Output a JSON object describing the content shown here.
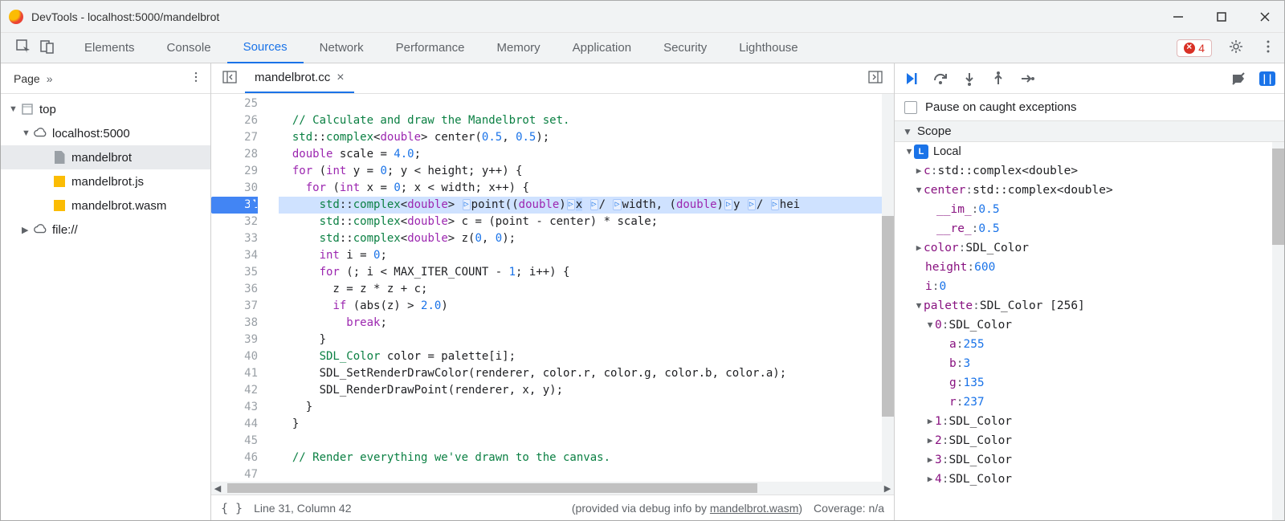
{
  "window": {
    "title": "DevTools - localhost:5000/mandelbrot"
  },
  "tabs": {
    "items": [
      "Elements",
      "Console",
      "Sources",
      "Network",
      "Performance",
      "Memory",
      "Application",
      "Security",
      "Lighthouse"
    ],
    "active": "Sources",
    "error_count": "4"
  },
  "nav": {
    "header": "Page",
    "tree": {
      "top": "top",
      "host": "localhost:5000",
      "files": [
        "mandelbrot",
        "mandelbrot.js",
        "mandelbrot.wasm"
      ],
      "filescheme": "file://",
      "selected": "mandelbrot"
    }
  },
  "editor": {
    "filename": "mandelbrot.cc",
    "first_line": 25,
    "breakpoint_line": 31,
    "lines": [
      "",
      "  // Calculate and draw the Mandelbrot set.",
      "  std::complex<double> center(0.5, 0.5);",
      "  double scale = 4.0;",
      "  for (int y = 0; y < height; y++) {",
      "    for (int x = 0; x < width; x++) {",
      "      std::complex<double> ▯point((double)▯x ▯/ ▯width, (double)▯y ▯/ ▯hei",
      "      std::complex<double> c = (point - center) * scale;",
      "      std::complex<double> z(0, 0);",
      "      int i = 0;",
      "      for (; i < MAX_ITER_COUNT - 1; i++) {",
      "        z = z * z + c;",
      "        if (abs(z) > 2.0)",
      "          break;",
      "      }",
      "      SDL_Color color = palette[i];",
      "      SDL_SetRenderDrawColor(renderer, color.r, color.g, color.b, color.a);",
      "      SDL_RenderDrawPoint(renderer, x, y);",
      "    }",
      "  }",
      "",
      "  // Render everything we've drawn to the canvas.",
      ""
    ]
  },
  "status": {
    "cursor": "Line 31, Column 42",
    "debuginfo_prefix": "(provided via debug info by ",
    "debuginfo_link": "mandelbrot.wasm",
    "debuginfo_suffix": ")",
    "coverage": "Coverage: n/a"
  },
  "debugger": {
    "pause_caught": "Pause on caught exceptions",
    "scope_label": "Scope",
    "local_label": "Local",
    "vars": {
      "c": {
        "type": "std::complex<double>"
      },
      "center": {
        "type": "std::complex<double>",
        "__im_": "0.5",
        "__re_": "0.5"
      },
      "color": {
        "type": "SDL_Color"
      },
      "height": "600",
      "i": "0",
      "palette": {
        "type": "SDL_Color [256]",
        "0": {
          "type": "SDL_Color",
          "a": "255",
          "b": "3",
          "g": "135",
          "r": "237"
        },
        "1": {
          "type": "SDL_Color"
        },
        "2": {
          "type": "SDL_Color"
        },
        "3": {
          "type": "SDL_Color"
        },
        "4": {
          "type": "SDL_Color"
        }
      }
    }
  }
}
